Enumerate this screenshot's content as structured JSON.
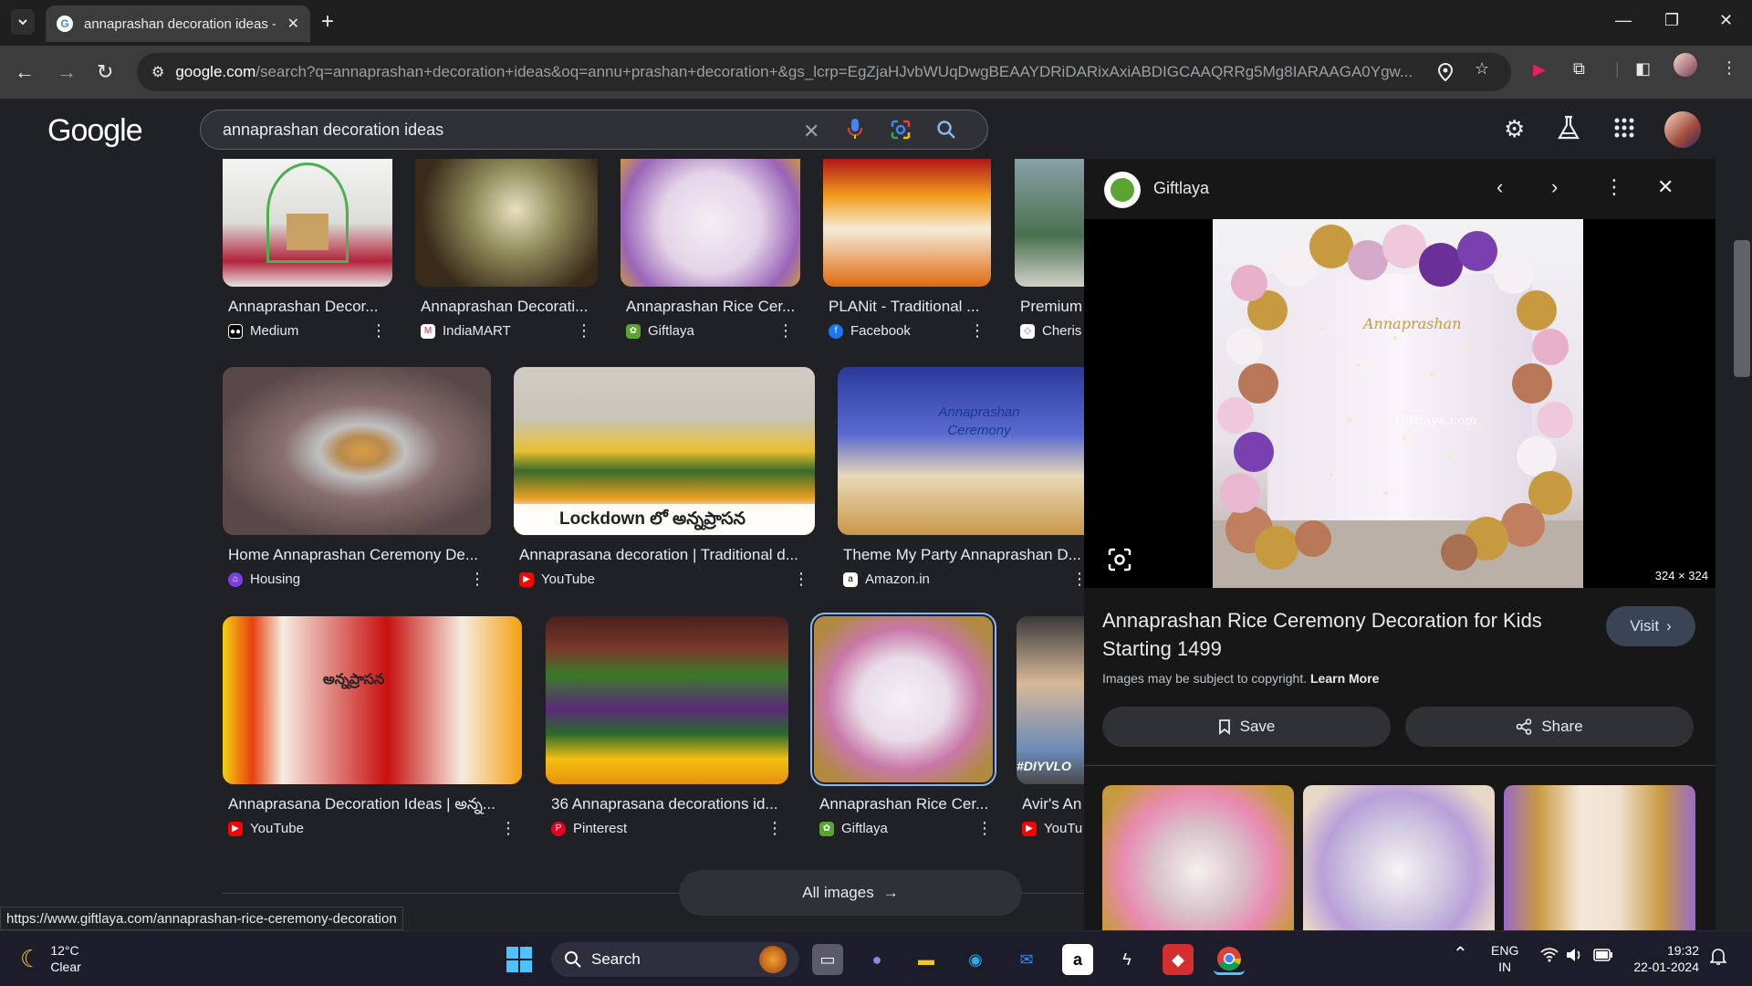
{
  "browser": {
    "tab_title": "annaprashan decoration ideas - Google Search",
    "url_host": "google.com",
    "url_rest": "/search?q=annaprashan+decoration+ideas&oq=annu+prashan+decoration+&gs_lcrp=EgZjaHJvbWUqDwgBEAAYDRiDARixAxiABDIGCAAQRRg5Mg8IARAAGA0Ygw..."
  },
  "google": {
    "logo": "Google",
    "query": "annaprashan decoration ideas"
  },
  "results": [
    {
      "caption": "Annaprashan Decor...",
      "source": "Medium",
      "icon_color": "#ffffff"
    },
    {
      "caption": "Annaprashan Decorati...",
      "source": "IndiaMART",
      "icon_color": "#d7263d"
    },
    {
      "caption": "Annaprashan Rice Cer...",
      "source": "Giftlaya",
      "icon_color": "#5aa432"
    },
    {
      "caption": "PLANit - Traditional ...",
      "source": "Facebook",
      "icon_color": "#1877f2"
    },
    {
      "caption": "Premium",
      "source": "Cheris",
      "icon_color": "#9b59b6"
    },
    {
      "caption": "Home Annaprashan Ceremony De...",
      "source": "Housing",
      "icon_color": "#7b3fe4"
    },
    {
      "caption": "Annaprasana decoration | Traditional d...",
      "source": "YouTube",
      "icon_color": "#ff0000"
    },
    {
      "caption": "Theme My Party Annaprashan D...",
      "source": "Amazon.in",
      "icon_color": "#ffffff"
    },
    {
      "caption": "Annaprasana Decoration Ideas | అన్న...",
      "source": "YouTube",
      "icon_color": "#ff0000"
    },
    {
      "caption": "36 Annaprasana decorations id...",
      "source": "Pinterest",
      "icon_color": "#e60023"
    },
    {
      "caption": "Annaprashan Rice Cer...",
      "source": "Giftlaya",
      "icon_color": "#5aa432"
    },
    {
      "caption": "Avir's An",
      "source": "YouTu",
      "icon_color": "#ff0000"
    }
  ],
  "image_text": {
    "lockdown": "Lockdown లో అన్నప్రాసన",
    "ceremony_sign": "Annaprashan Ceremony",
    "diy": "#DIYVLO"
  },
  "all_images_label": "All images",
  "panel": {
    "source": "Giftlaya",
    "dimensions": "324 × 324",
    "title": "Annaprashan Rice Ceremony Decoration for Kids Starting 1499",
    "visit_label": "Visit",
    "copyright_text": "Images may be subject to copyright.",
    "learn_more": "Learn More",
    "save_label": "Save",
    "share_label": "Share",
    "watermark": "Giftlaya.com",
    "script_text": "Annaprashan"
  },
  "status_url": "https://www.giftlaya.com/annaprashan-rice-ceremony-decoration",
  "taskbar": {
    "temp": "12°C",
    "condition": "Clear",
    "search_label": "Search",
    "lang_top": "ENG",
    "lang_bottom": "IN",
    "time": "19:32",
    "date": "22-01-2024"
  }
}
